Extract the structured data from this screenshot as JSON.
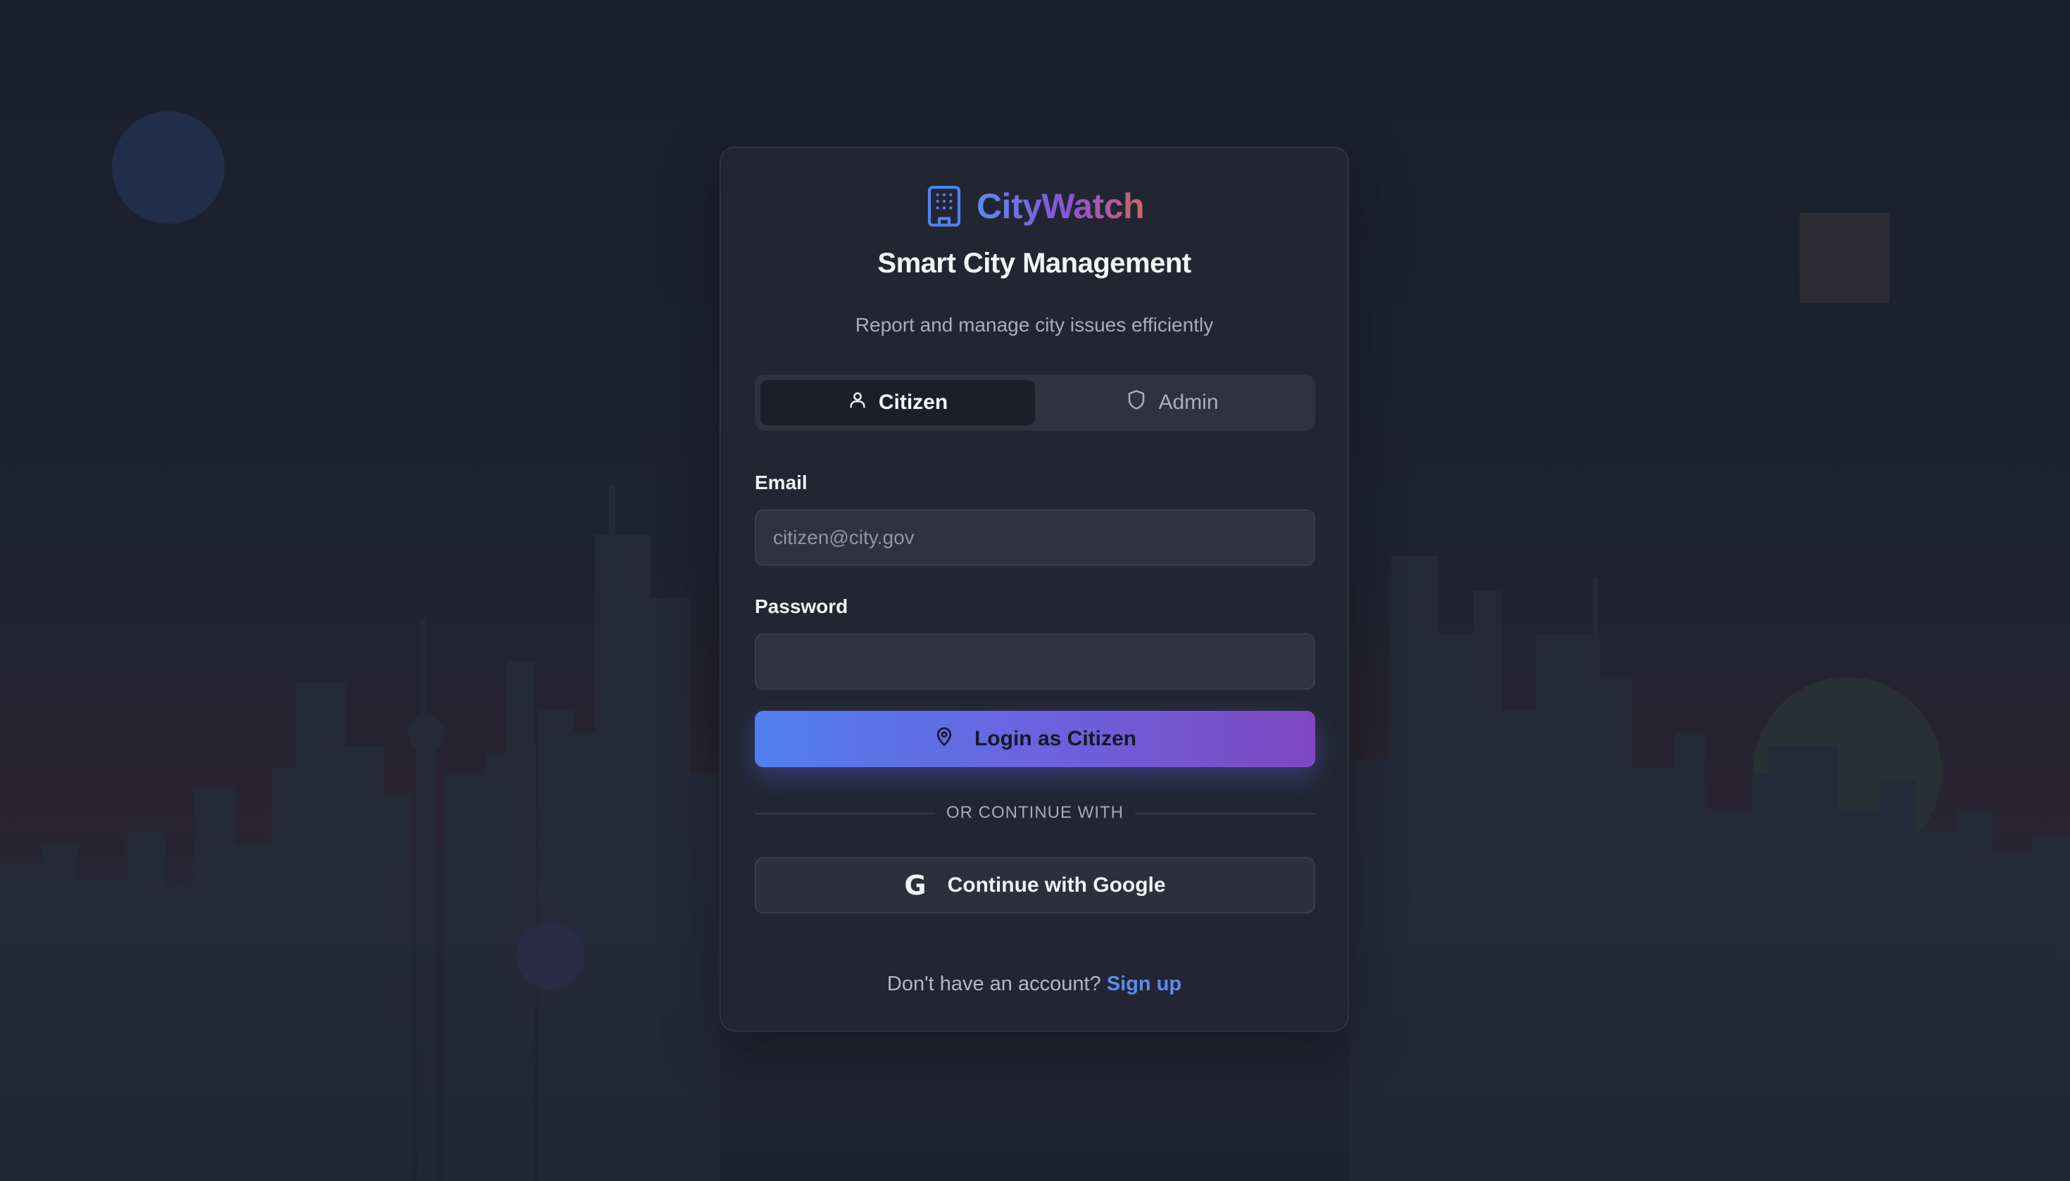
{
  "app": {
    "name": "CityWatch",
    "brand_icon": "building-icon",
    "heading": "Smart City Management",
    "subtitle": "Report and manage city issues efficiently"
  },
  "role_toggle": {
    "selected": "Citizen",
    "tabs": [
      {
        "label": "Citizen",
        "icon": "user-icon",
        "active": true
      },
      {
        "label": "Admin",
        "icon": "shield-icon",
        "active": false
      }
    ]
  },
  "form": {
    "email_label": "Email",
    "email_placeholder": "citizen@city.gov",
    "email_value": "",
    "password_label": "Password",
    "password_value": ""
  },
  "login_button": {
    "label": "Login as Citizen",
    "icon": "map-pin-icon"
  },
  "divider_text": "OR CONTINUE WITH",
  "google_button": {
    "label": "Continue with Google",
    "icon": "google-icon",
    "icon_glyph": "G"
  },
  "footer": {
    "prompt": "Don't have an account?",
    "link": "Sign up"
  },
  "colors": {
    "accent_blue": "#4f7fee",
    "accent_purple": "#7f48c2",
    "link": "#5a8cf0",
    "card_bg": "#232632",
    "page_bg": "#1b1f2e"
  }
}
